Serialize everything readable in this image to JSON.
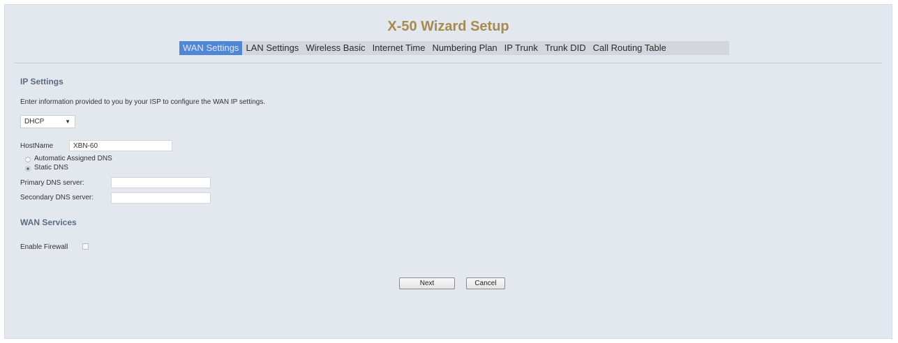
{
  "header": {
    "title": "X-50 Wizard Setup"
  },
  "tabs": [
    {
      "label": "WAN Settings",
      "active": true
    },
    {
      "label": "LAN Settings",
      "active": false
    },
    {
      "label": "Wireless Basic",
      "active": false
    },
    {
      "label": "Internet Time",
      "active": false
    },
    {
      "label": "Numbering Plan",
      "active": false
    },
    {
      "label": "IP Trunk",
      "active": false
    },
    {
      "label": "Trunk DID",
      "active": false
    },
    {
      "label": "Call Routing Table",
      "active": false
    }
  ],
  "ip_settings": {
    "title": "IP Settings",
    "instruction": "Enter information provided to you by your ISP to configure the WAN IP settings.",
    "mode_select": {
      "value": "DHCP",
      "arrow": "▼"
    },
    "hostname": {
      "label": "HostName",
      "value": "XBN-60"
    },
    "dns_options": [
      {
        "label": "Automatic Assigned DNS",
        "checked": false
      },
      {
        "label": "Static DNS",
        "checked": true
      }
    ],
    "primary_dns": {
      "label": "Primary DNS server:",
      "value": ""
    },
    "secondary_dns": {
      "label": "Secondary DNS server:",
      "value": ""
    }
  },
  "wan_services": {
    "title": "WAN Services",
    "firewall": {
      "label": "Enable Firewall",
      "checked": false
    }
  },
  "buttons": {
    "next": "Next",
    "cancel": "Cancel"
  },
  "colors": {
    "panel_bg": "#e3e7ee",
    "title": "#a88a4e",
    "tab_active": "#4f86d6",
    "section_title": "#5b6b84"
  }
}
